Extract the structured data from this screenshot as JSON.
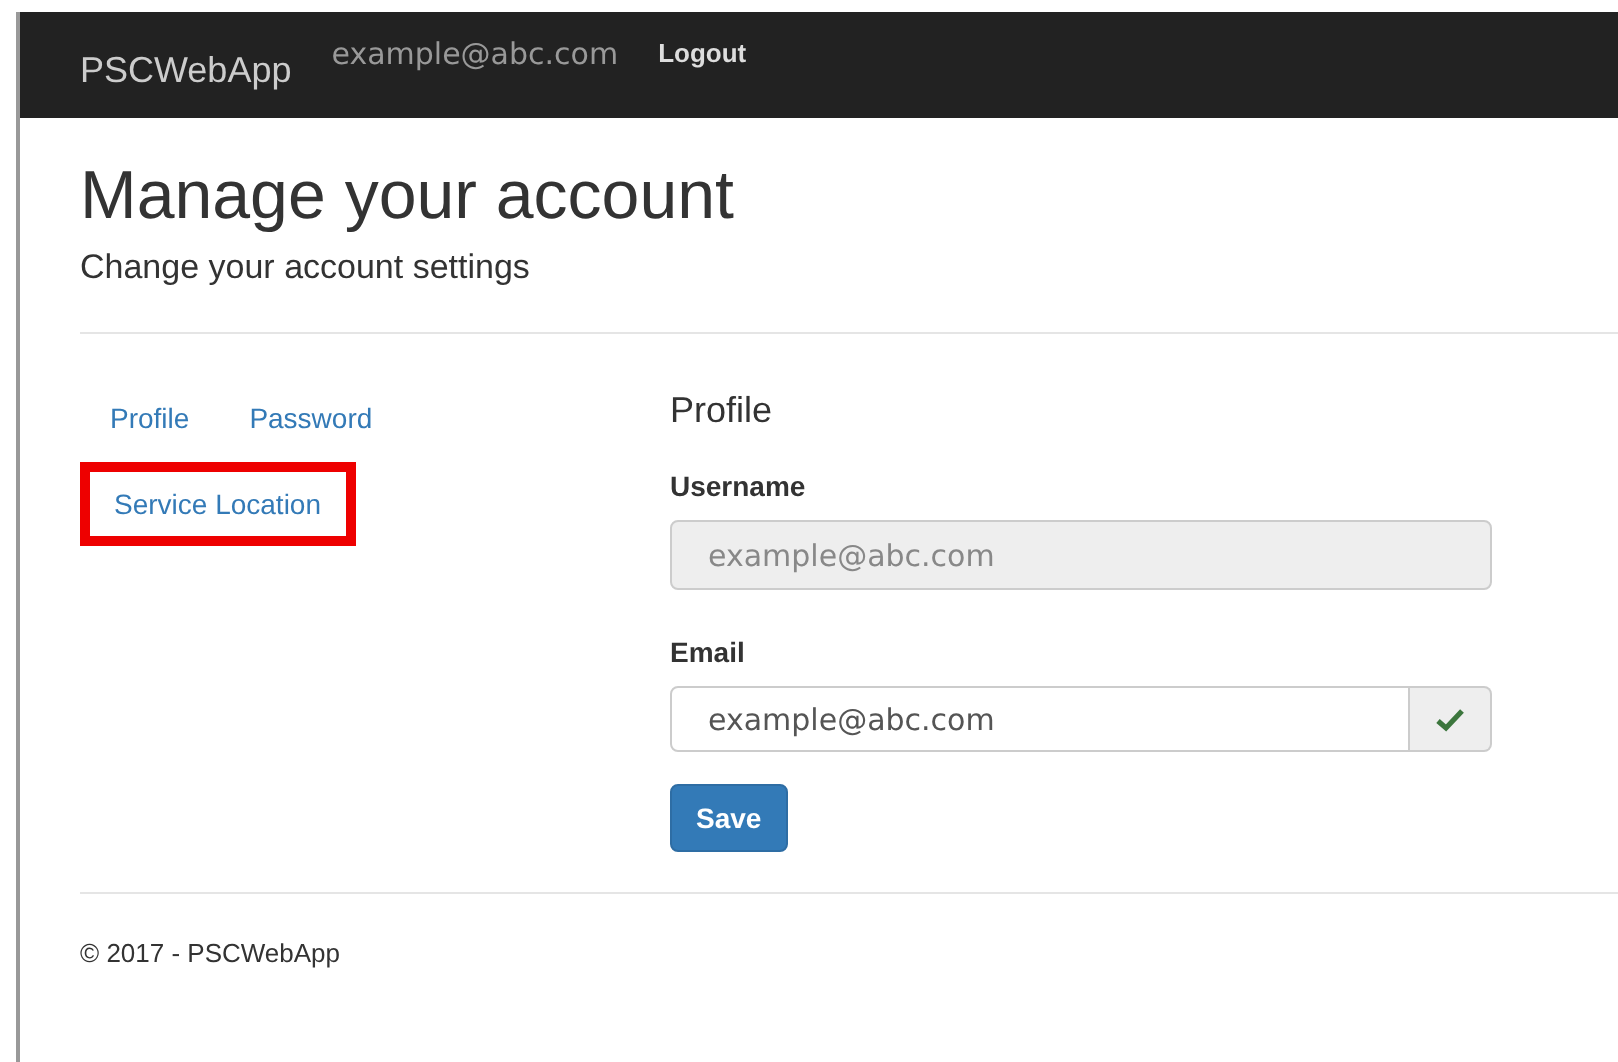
{
  "navbar": {
    "brand": "PSCWebApp",
    "user": "example@abc.com",
    "logout": "Logout"
  },
  "header": {
    "title": "Manage your account",
    "subtitle": "Change your account settings"
  },
  "side_links": [
    {
      "label": "Profile",
      "highlighted": false
    },
    {
      "label": "Password",
      "highlighted": false
    },
    {
      "label": "Service Location",
      "highlighted": true
    }
  ],
  "form": {
    "heading": "Profile",
    "fields": [
      {
        "label": "Username",
        "value": "example@abc.com",
        "disabled": true,
        "valid": false
      },
      {
        "label": "Email",
        "value": "example@abc.com",
        "disabled": false,
        "valid": true
      }
    ],
    "button": "Save"
  },
  "footer": "© 2017 - PSCWebApp"
}
